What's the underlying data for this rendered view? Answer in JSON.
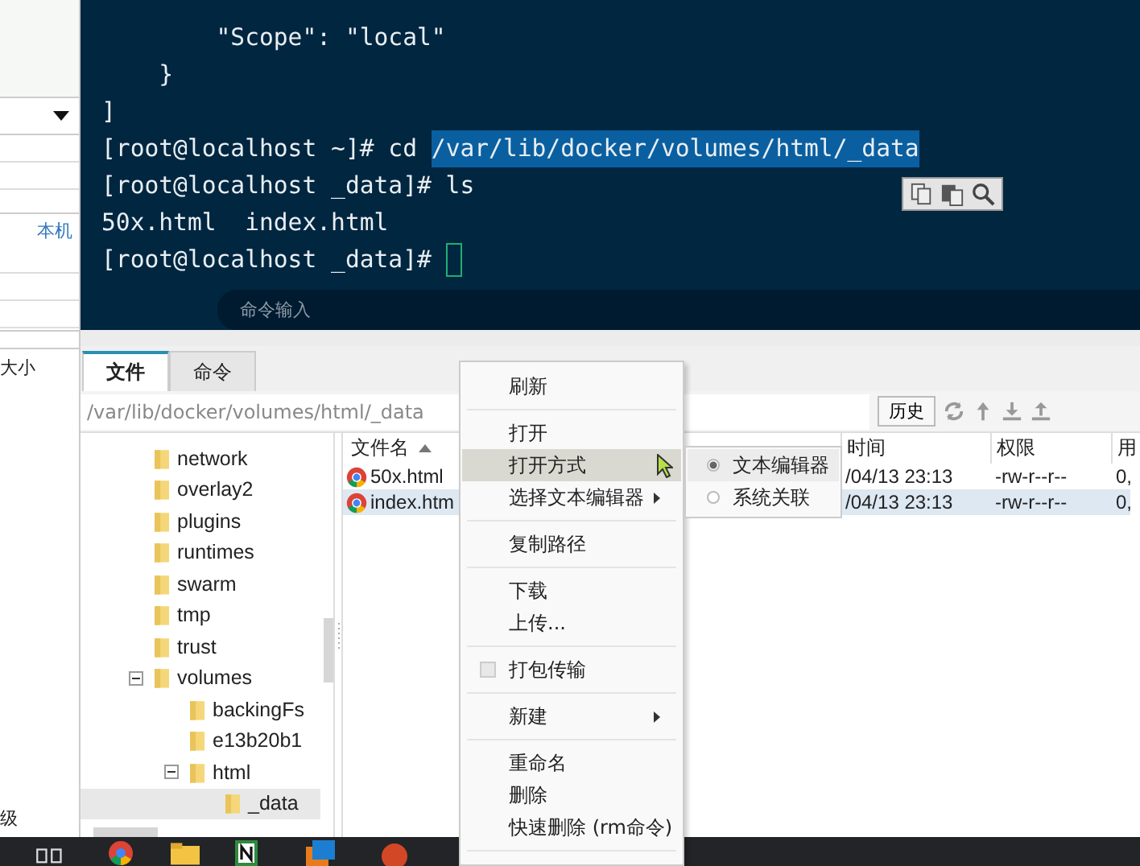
{
  "left_pane": {
    "link": "本机",
    "column_header": "大小",
    "bottom_label": "级"
  },
  "terminal": {
    "lines": [
      {
        "segments": [
          {
            "text": "        \"Scope\": \"local\"",
            "selected": false
          }
        ],
        "cursor": false
      },
      {
        "segments": [
          {
            "text": "    }",
            "selected": false
          }
        ],
        "cursor": false
      },
      {
        "segments": [
          {
            "text": "]",
            "selected": false
          }
        ],
        "cursor": false
      },
      {
        "segments": [
          {
            "text": "[root@localhost ~]# cd ",
            "selected": false
          },
          {
            "text": "/var/lib/docker/volumes/html/_data",
            "selected": true
          }
        ],
        "cursor": false
      },
      {
        "segments": [
          {
            "text": "[root@localhost _data]# ls",
            "selected": false
          }
        ],
        "cursor": false
      },
      {
        "segments": [
          {
            "text": "50x.html  index.html",
            "selected": false
          }
        ],
        "cursor": false
      },
      {
        "segments": [
          {
            "text": "[root@localhost _data]# ",
            "selected": false
          }
        ],
        "cursor": true
      }
    ],
    "command_input": {
      "placeholder": "命令输入"
    }
  },
  "tabs": [
    {
      "label": "文件",
      "selected": true
    },
    {
      "label": "命令",
      "selected": false
    }
  ],
  "path_field": {
    "value": "/var/lib/docker/volumes/html/_data"
  },
  "history_button": "历史",
  "tree": [
    {
      "label": "network",
      "selected": false
    },
    {
      "label": "overlay2",
      "selected": false
    },
    {
      "label": "plugins",
      "selected": false
    },
    {
      "label": "runtimes",
      "selected": false
    },
    {
      "label": "swarm",
      "selected": false
    },
    {
      "label": "tmp",
      "selected": false
    },
    {
      "label": "trust",
      "selected": false
    },
    {
      "label": "volumes",
      "selected": false,
      "expanded": true,
      "children": [
        {
          "label": "backingFs",
          "selected": false
        },
        {
          "label": "e13b20b1",
          "selected": false
        },
        {
          "label": "html",
          "selected": false,
          "expanded": true,
          "children": [
            {
              "label": "_data",
              "selected": true
            }
          ]
        }
      ]
    }
  ],
  "file_list": {
    "columns": [
      "文件名",
      "时间",
      "权限",
      "用"
    ],
    "rows": [
      {
        "name": "50x.html",
        "time": "/04/13 23:13",
        "permissions": "-rw-r--r--",
        "column_4": "0,",
        "selected": false
      },
      {
        "name": "index.htm",
        "time": "/04/13 23:13",
        "permissions": "-rw-r--r--",
        "column_4": "0,",
        "selected": true
      }
    ]
  },
  "context_menu": [
    {
      "kind": "item",
      "label": "刷新",
      "selected": false,
      "submenu": false
    },
    {
      "kind": "separator"
    },
    {
      "kind": "item",
      "label": "打开",
      "selected": false,
      "submenu": false
    },
    {
      "kind": "item",
      "label": "打开方式",
      "selected": true,
      "submenu": false
    },
    {
      "kind": "item",
      "label": "选择文本编辑器",
      "selected": false,
      "submenu": true
    },
    {
      "kind": "separator"
    },
    {
      "kind": "item",
      "label": "复制路径",
      "selected": false,
      "submenu": false
    },
    {
      "kind": "separator"
    },
    {
      "kind": "item",
      "label": "下载",
      "selected": false,
      "submenu": false
    },
    {
      "kind": "item",
      "label": "上传...",
      "selected": false,
      "submenu": false
    },
    {
      "kind": "separator"
    },
    {
      "kind": "checkbox",
      "label": "打包传输",
      "checked": false
    },
    {
      "kind": "separator"
    },
    {
      "kind": "item",
      "label": "新建",
      "selected": false,
      "submenu": true
    },
    {
      "kind": "separator"
    },
    {
      "kind": "item",
      "label": "重命名",
      "selected": false,
      "submenu": false
    },
    {
      "kind": "item",
      "label": "删除",
      "selected": false,
      "submenu": false
    },
    {
      "kind": "item",
      "label": "快速删除 (rm命令)",
      "selected": false,
      "submenu": false
    },
    {
      "kind": "separator"
    }
  ],
  "open_with_submenu": [
    {
      "label": "文本编辑器",
      "selected": true
    },
    {
      "label": "系统关联",
      "selected": false
    }
  ]
}
